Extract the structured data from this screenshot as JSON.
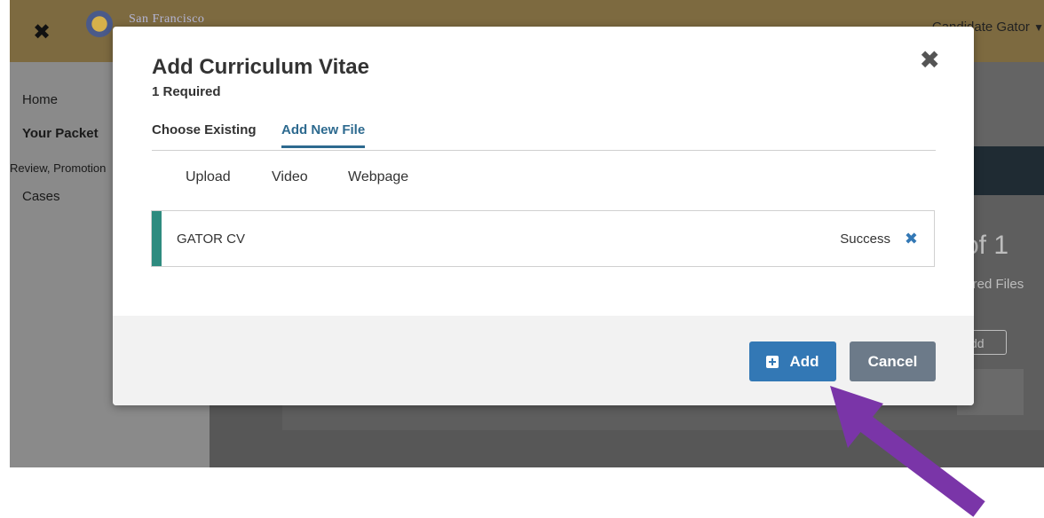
{
  "app": {
    "brand": "San Francisco",
    "user_name": "Candidate Gator",
    "close_glyph": "✖"
  },
  "sidebar": {
    "items": [
      {
        "label": "Home"
      },
      {
        "label": "Your Packet"
      },
      {
        "label": "Review, Promotion"
      },
      {
        "label": "Cases"
      }
    ]
  },
  "background": {
    "count_text": "of 1",
    "required_files_text": "uired Files",
    "add_text": "dd"
  },
  "modal": {
    "title": "Add Curriculum Vitae",
    "subtitle": "1 Required",
    "close_icon": "✖",
    "tabs": [
      {
        "label": "Choose Existing",
        "active": false
      },
      {
        "label": "Add New File",
        "active": true
      }
    ],
    "subtabs": [
      {
        "label": "Upload"
      },
      {
        "label": "Video"
      },
      {
        "label": "Webpage"
      }
    ],
    "file": {
      "name": "GATOR CV",
      "status": "Success",
      "remove_icon": "✖",
      "accent_color": "#2e8b7f"
    },
    "buttons": {
      "add": "Add",
      "cancel": "Cancel"
    }
  },
  "annotation": {
    "arrow_color": "#7a35a8",
    "target": "add-button"
  }
}
